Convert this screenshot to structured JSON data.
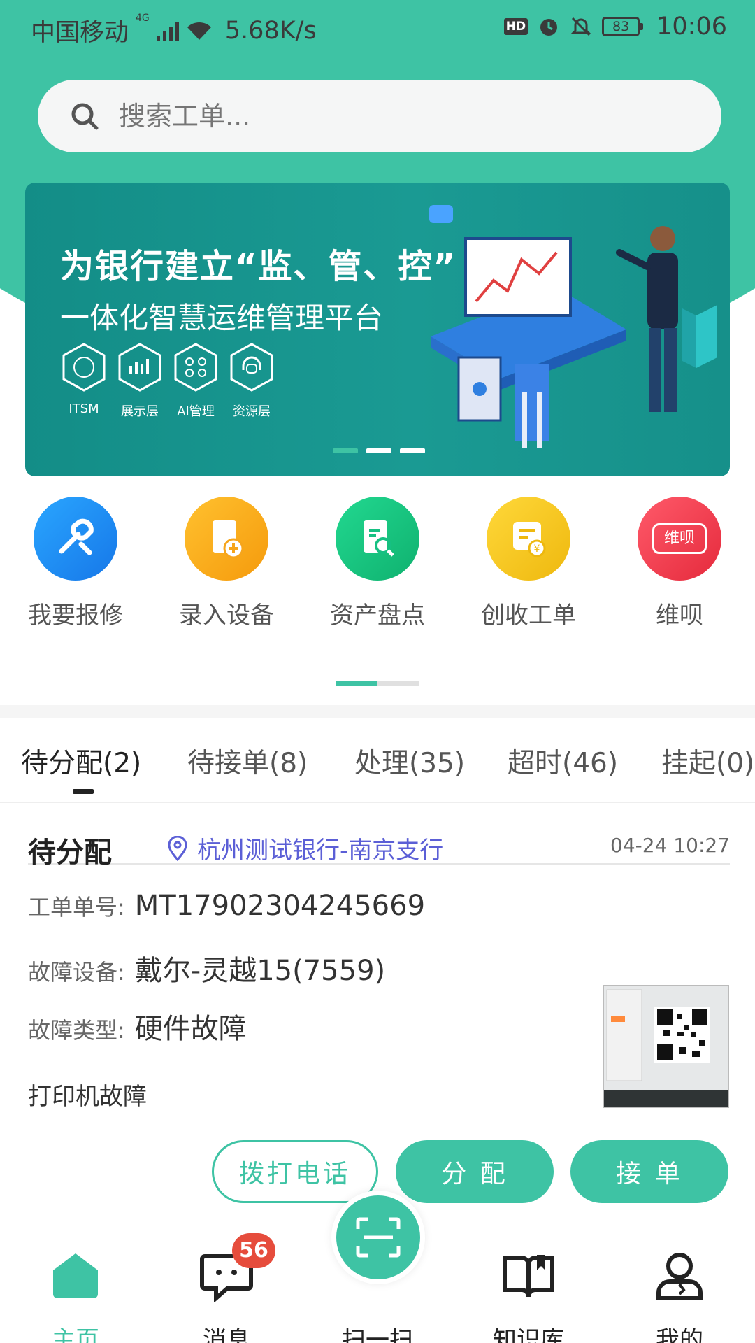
{
  "status_bar": {
    "carrier": "中国移动",
    "net_tag": "4G",
    "speed": "5.68K/s",
    "hd": "HD",
    "battery": "83",
    "time": "10:06"
  },
  "search": {
    "placeholder": "搜索工单..."
  },
  "banner": {
    "title": "为银行建立“监、管、控”",
    "subtitle": "一体化智慧运维管理平台",
    "chips": [
      "ITSM",
      "展示层",
      "AI管理",
      "资源层"
    ],
    "pages": 3,
    "active_page": 1
  },
  "quick_actions": [
    {
      "label": "我要报修",
      "icon": "repair-icon",
      "color": "#1e8ff0"
    },
    {
      "label": "录入设备",
      "icon": "add-device-icon",
      "color": "#f6a51c"
    },
    {
      "label": "资产盘点",
      "icon": "asset-check-icon",
      "color": "#16c082"
    },
    {
      "label": "创收工单",
      "icon": "revenue-order-icon",
      "color": "#f2c81d"
    },
    {
      "label": "维呗",
      "icon": "weibei-logo-icon",
      "color": "#ef3c4c",
      "icon_text": "维呗"
    }
  ],
  "tabs": [
    {
      "label": "待分配(2)",
      "active": true
    },
    {
      "label": "待接单(8)"
    },
    {
      "label": "处理(35)"
    },
    {
      "label": "超时(46)"
    },
    {
      "label": "挂起(0)"
    }
  ],
  "order": {
    "status": "待分配",
    "location": "杭州测试银行-南京支行",
    "time": "04-24 10:27",
    "id_label": "工单单号:",
    "id_value": "MT17902304245669",
    "device_label": "故障设备:",
    "device_value": "戴尔-灵越15(7559)",
    "type_label": "故障类型:",
    "type_value": "硬件故障",
    "description": "打印机故障",
    "actions": {
      "call": "拨打电话",
      "assign": "分 配",
      "accept": "接 单"
    }
  },
  "bottom_nav": {
    "home": "主页",
    "messages": "消息",
    "messages_badge": "56",
    "scan": "扫一扫",
    "knowledge": "知识库",
    "mine": "我的"
  },
  "colors": {
    "brand": "#3ec3a4",
    "badge": "#e64c3c",
    "link": "#5b5fd6"
  }
}
